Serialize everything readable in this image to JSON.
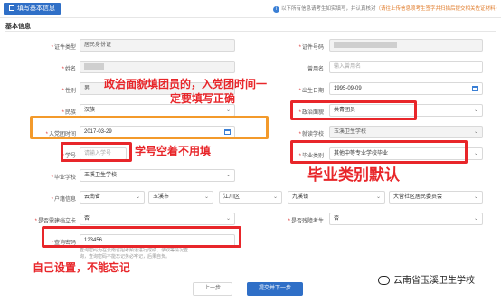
{
  "header": {
    "tab_title": "填写基本信息",
    "notice_main": "以下所有信息请考生如实填写，并认真核对",
    "notice_warn": "（请往上传信息须考生签字并扫描后提交相关佐证材料）",
    "info_glyph": "i"
  },
  "section_title": "基本信息",
  "form": {
    "id_type": {
      "label": "证件类型",
      "value": "居民身份证"
    },
    "id_number": {
      "label": "证件号码"
    },
    "name": {
      "label": "姓名"
    },
    "used_name": {
      "label": "曾用名",
      "placeholder": "输入曾用名"
    },
    "gender": {
      "label": "性别",
      "value": "男"
    },
    "birth": {
      "label": "出生日期",
      "value": "1995-09-09"
    },
    "ethnicity": {
      "label": "民族",
      "value": "汉族"
    },
    "political": {
      "label": "政治面貌",
      "value": "共青团员"
    },
    "join_date": {
      "label": "入党团时间",
      "value": "2017-03-29"
    },
    "school": {
      "label": "就读学校",
      "value": "玉溪卫生学校"
    },
    "student_no": {
      "label": "学号",
      "placeholder": "请输入学号"
    },
    "grad_type": {
      "label": "毕业类别",
      "value": "其他中等专业学校毕业"
    },
    "grad_school": {
      "label": "毕业学校",
      "value": "玉溪卫生学校"
    },
    "household": {
      "label": "户籍信息",
      "province": "云南省",
      "city": "玉溪市",
      "district": "江川区",
      "town": "九溪镇",
      "village": "大营社区居民委员会"
    },
    "record_card": {
      "label": "是否需建档立卡",
      "value": "否"
    },
    "disabled": {
      "label": "是否残障考生",
      "value": "否"
    },
    "query_pwd": {
      "label": "查询密码",
      "value": "123456"
    }
  },
  "hint_line1": "查询密码为在云南省招考频道进行成绩、录取等情况查",
  "hint_line2": "询，查询密码不能忘记务必牢记，后果自负。",
  "buttons": {
    "prev": "上一步",
    "next": "提交并下一步"
  },
  "annotations": {
    "political_note_1": "政治面貌填团员的，入党团时间一",
    "political_note_2": "定要填写正确",
    "student_no_note": "学号空着不用填",
    "grad_type_note": "毕业类别默认",
    "pwd_note": "自己设置，不能忘记"
  },
  "watermark": "云南省玉溪卫生学校",
  "colors": {
    "primary": "#2f6fc7",
    "annotation_red": "#e8262a",
    "annotation_orange": "#f39a2b"
  }
}
